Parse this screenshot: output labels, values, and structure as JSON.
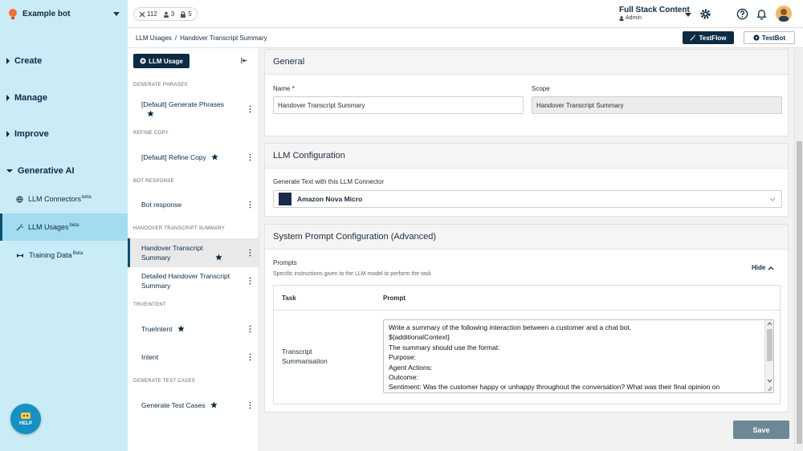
{
  "bot": {
    "name": "Example bot"
  },
  "stats": [
    {
      "icon": "tools-icon",
      "value": "112"
    },
    {
      "icon": "users-icon",
      "value": "3"
    },
    {
      "icon": "lock-icon",
      "value": "5"
    }
  ],
  "workspace": {
    "name": "Full Stack Content",
    "role": "Admin"
  },
  "nav": {
    "create": "Create",
    "manage": "Manage",
    "improve": "Improve",
    "generative_ai": "Generative AI",
    "sub_items": [
      {
        "label": "LLM Connectors",
        "badge": "beta"
      },
      {
        "label": "LLM Usages",
        "badge": "beta"
      },
      {
        "label": "Training Data",
        "badge": "Beta"
      }
    ]
  },
  "help": {
    "label": "HELP"
  },
  "breadcrumb": {
    "root": "LLM Usages",
    "separator": "/",
    "current": "Handover Transcript Summary"
  },
  "buttons": {
    "testflow": "TestFlow",
    "testbot": "TestBot",
    "llm_usage": "LLM Usage",
    "save": "Save"
  },
  "usage_groups": {
    "generate_phrases": "GENERATE PHRASES",
    "refine_copy": "REFINE COPY",
    "bot_response": "BOT RESPONSE",
    "handover": "HANDOVER TRANSCRIPT SUMMARY",
    "trueintent": "TRUEINTENT",
    "generate_test_cases": "GENERATE TEST CASES"
  },
  "usage_items": {
    "default_generate_phrases": "[Default] Generate Phrases",
    "default_refine_copy": "[Default] Refine Copy",
    "bot_response": "Bot response",
    "handover_summary": "Handover Transcript Summary",
    "detailed_handover": "Detailed Handover Transcript Summary",
    "trueintent": "TrueIntent",
    "intent": "Intent",
    "generate_test_cases": "Generate Test Cases"
  },
  "general": {
    "title": "General",
    "name_label": "Name *",
    "name_value": "Handover Transcript Summary",
    "scope_label": "Scope",
    "scope_value": "Handover Transcript Summary"
  },
  "llm_config": {
    "title": "LLM Configuration",
    "connector_label": "Generate Text with this LLM Connector",
    "connector_value": "Amazon Nova Micro"
  },
  "system_prompt": {
    "title": "System Prompt Configuration (Advanced)",
    "prompts_label": "Prompts",
    "prompts_help": "Specific instructions given to the LLM model to perform the task",
    "hide_label": "Hide",
    "table_task_header": "Task",
    "table_prompt_header": "Prompt",
    "task_name": "Transcript Summarisation",
    "prompt_lines": [
      "Write a summary of the following interaction between a customer and a chat bot.",
      "${additionalContext}",
      "The summary should use the format:",
      "Purpose:",
      "Agent Actions:",
      "Outcome:",
      "Sentiment: Was the customer happy or unhappy throughout the conversation? What was their final opinion on"
    ]
  },
  "colors": {
    "sidebar": "#c9ecf7",
    "primary": "#0d2b44",
    "save_button": "#6b8995"
  }
}
